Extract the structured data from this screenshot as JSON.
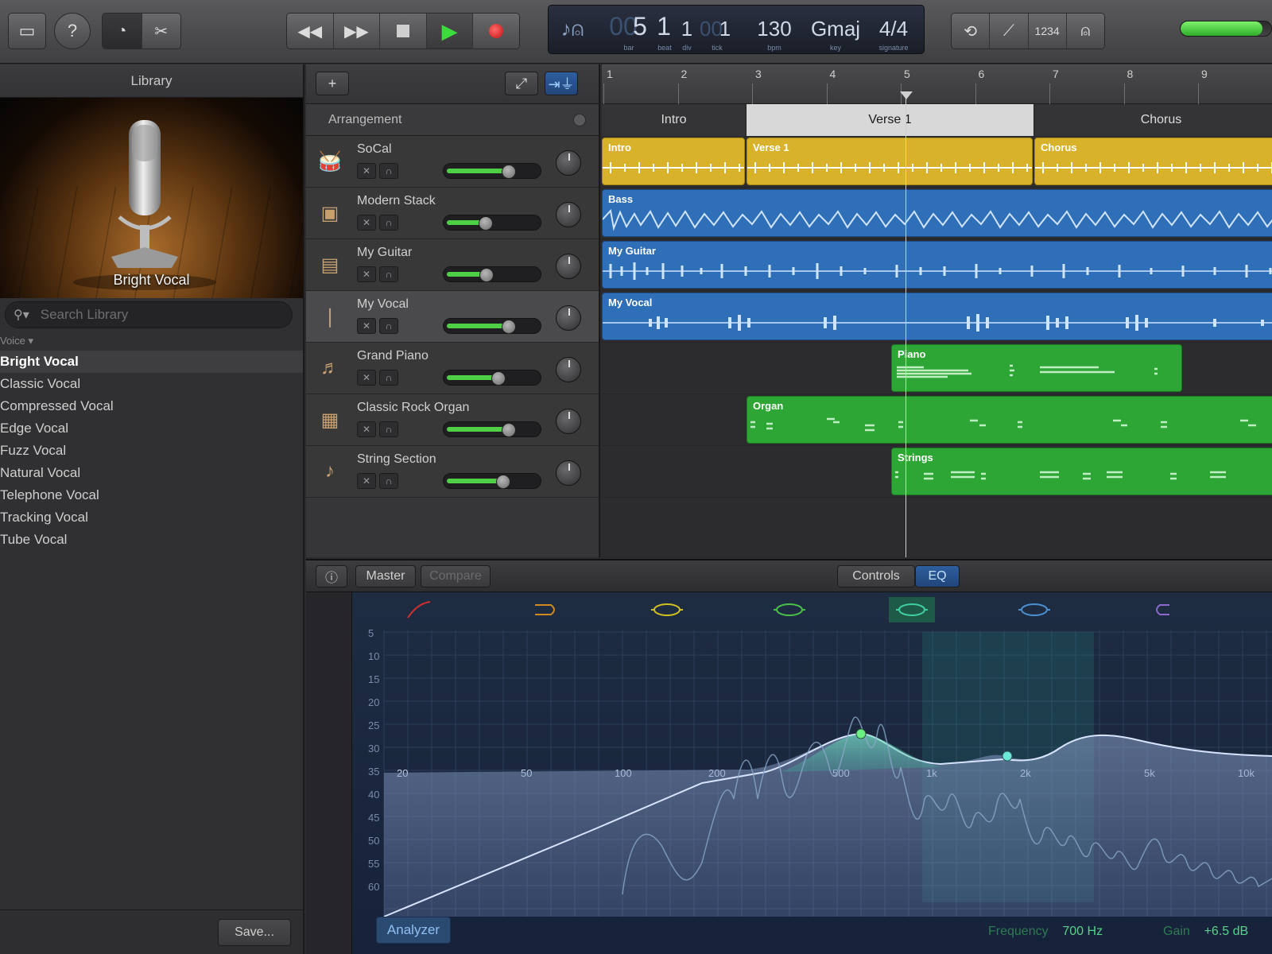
{
  "toolbar": {
    "lcd": {
      "bar": "5",
      "beat": "1",
      "div": "1",
      "tick": "1",
      "bar_dim": "00",
      "tick_dim": "00",
      "tempo": "130",
      "key": "Gmaj",
      "signature": "4/4",
      "labels": {
        "bar": "bar",
        "beat": "beat",
        "div": "div",
        "tick": "tick",
        "tempo": "bpm",
        "key": "key",
        "signature": "signature"
      }
    },
    "count_in_label": "1234",
    "master_level": 0.9
  },
  "library": {
    "title": "Library",
    "patch_name": "Bright Vocal",
    "search_placeholder": "Search Library",
    "category": "Voice",
    "items": [
      {
        "label": "Bright Vocal",
        "selected": true
      },
      {
        "label": "Classic Vocal",
        "selected": false
      },
      {
        "label": "Compressed Vocal",
        "selected": false
      },
      {
        "label": "Edge Vocal",
        "selected": false
      },
      {
        "label": "Fuzz Vocal",
        "selected": false
      },
      {
        "label": "Natural Vocal",
        "selected": false
      },
      {
        "label": "Telephone Vocal",
        "selected": false
      },
      {
        "label": "Tracking Vocal",
        "selected": false
      },
      {
        "label": "Tube Vocal",
        "selected": false
      }
    ],
    "save_label": "Save..."
  },
  "arrangement": {
    "header_label": "Arrangement",
    "ruler": [
      "1",
      "2",
      "3",
      "4",
      "5",
      "6",
      "7",
      "8",
      "9"
    ],
    "sections": [
      "Intro",
      "Verse 1",
      "Chorus"
    ],
    "selected_section": "Verse 1"
  },
  "tracks": [
    {
      "name": "SoCal",
      "volume": 0.72,
      "icon": "drum-kit-icon",
      "color": "#d8b22a"
    },
    {
      "name": "Modern Stack",
      "volume": 0.45,
      "icon": "bass-amp-icon",
      "color": "#2f6fb8"
    },
    {
      "name": "My Guitar",
      "volume": 0.46,
      "icon": "guitar-amp-icon",
      "color": "#2f6fb8"
    },
    {
      "name": "My Vocal",
      "volume": 0.72,
      "icon": "microphone-icon",
      "color": "#2f6fb8",
      "selected": true
    },
    {
      "name": "Grand Piano",
      "volume": 0.6,
      "icon": "piano-icon",
      "color": "#2ea636"
    },
    {
      "name": "Classic Rock Organ",
      "volume": 0.72,
      "icon": "organ-icon",
      "color": "#2ea636"
    },
    {
      "name": "String Section",
      "volume": 0.65,
      "icon": "violin-icon",
      "color": "#2ea636"
    }
  ],
  "regions": {
    "intro": "Intro",
    "verse1": "Verse 1",
    "chorus": "Chorus",
    "bass": "Bass",
    "guitar": "My Guitar",
    "vocal": "My Vocal",
    "piano": "Piano",
    "organ": "Organ",
    "strings": "Strings"
  },
  "editor": {
    "tabs": {
      "master": "Master",
      "compare": "Compare",
      "controls": "Controls",
      "eq": "EQ"
    },
    "analyzer": "Analyzer",
    "db_labels": [
      "5",
      "10",
      "15",
      "20",
      "25",
      "30",
      "35",
      "40",
      "45",
      "50",
      "55",
      "60"
    ],
    "freq_labels": [
      "20",
      "50",
      "100",
      "200",
      "500",
      "1k",
      "2k",
      "5k",
      "10k"
    ],
    "readout": {
      "frequency_label": "Frequency",
      "frequency_value": "700 Hz",
      "gain_label": "Gain",
      "gain_value": "+6.5 dB"
    }
  },
  "colors": {
    "accent": "#2e5f9e",
    "play": "#3ddc3d",
    "record": "#d01818",
    "audio": "#2f6fb8",
    "drums": "#d8b22a",
    "midi": "#2ea636",
    "eq_curve": "#4fd0a8"
  }
}
